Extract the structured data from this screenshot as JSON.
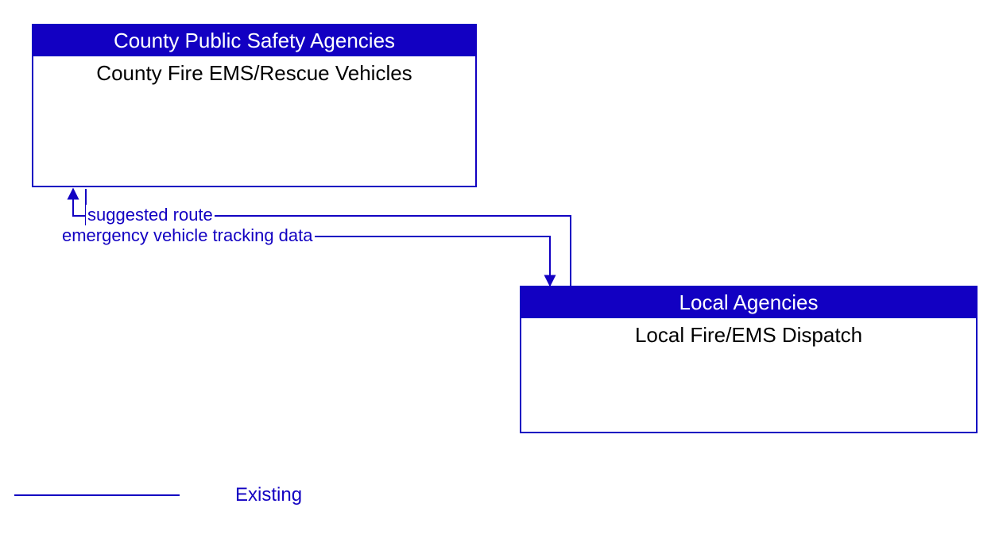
{
  "entities": {
    "county": {
      "header": "County Public Safety Agencies",
      "body": "County Fire EMS/Rescue Vehicles"
    },
    "local": {
      "header": "Local Agencies",
      "body": "Local Fire/EMS Dispatch"
    }
  },
  "flows": {
    "suggested_route": "suggested route",
    "tracking_data": "emergency vehicle tracking data"
  },
  "legend": {
    "existing": "Existing"
  },
  "colors": {
    "brand": "#1200c2"
  }
}
